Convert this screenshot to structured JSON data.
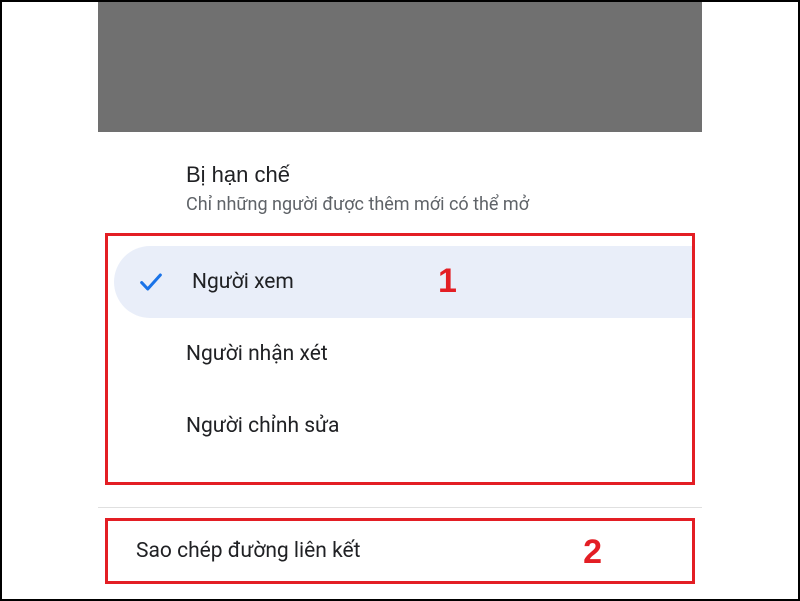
{
  "section": {
    "title": "Bị hạn chế",
    "subtitle": "Chỉ những người được thêm mới có thể mở"
  },
  "options": {
    "viewer": "Người xem",
    "commenter": "Người nhận xét",
    "editor": "Người chỉnh sửa"
  },
  "copy_link": "Sao chép đường liên kết",
  "annotations": {
    "one": "1",
    "two": "2"
  }
}
